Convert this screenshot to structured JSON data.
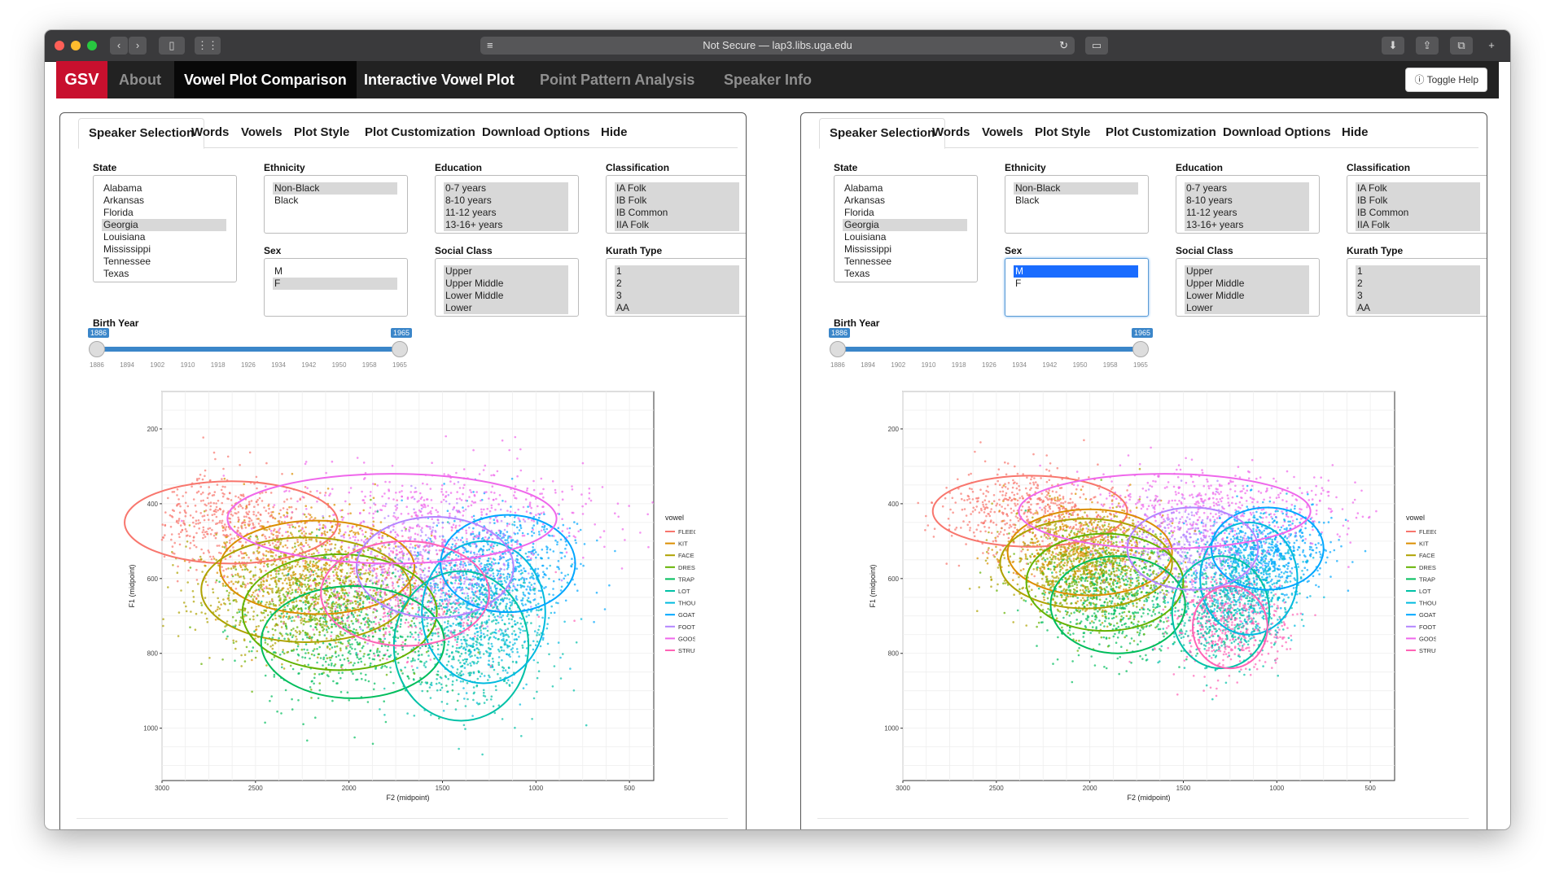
{
  "browser": {
    "url_text": "Not Secure — lap3.libs.uga.edu"
  },
  "navbar": {
    "brand": "GSV",
    "links": [
      "About",
      "Vowel Plot Comparison",
      "Interactive Vowel Plot",
      "Point Pattern Analysis",
      "Speaker Info"
    ],
    "toggle_help": "Toggle Help"
  },
  "tabs": [
    "Speaker Selection",
    "Words",
    "Vowels",
    "Plot Style",
    "Plot Customization",
    "Download Options",
    "Hide"
  ],
  "labels": {
    "state": "State",
    "ethnicity": "Ethnicity",
    "education": "Education",
    "classification": "Classification",
    "sex": "Sex",
    "social_class": "Social Class",
    "kurath_type": "Kurath Type",
    "birth_year": "Birth Year"
  },
  "options": {
    "state": [
      "Alabama",
      "Arkansas",
      "Florida",
      "Georgia",
      "Louisiana",
      "Mississippi",
      "Tennessee",
      "Texas"
    ],
    "ethnicity": [
      "Non-Black",
      "Black"
    ],
    "education": [
      "0-7 years",
      "8-10 years",
      "11-12 years",
      "13-16+ years"
    ],
    "classification": [
      "IA Folk",
      "IB Folk",
      "IB Common",
      "IIA Folk"
    ],
    "sex": [
      "M",
      "F"
    ],
    "social_class": [
      "Upper",
      "Upper Middle",
      "Lower Middle",
      "Lower"
    ],
    "kurath_type": [
      "1",
      "2",
      "3",
      "AA"
    ]
  },
  "left_panel": {
    "selected": {
      "state": [
        "Georgia"
      ],
      "ethnicity": [
        "Non-Black"
      ],
      "education": [
        "0-7 years",
        "8-10 years",
        "11-12 years",
        "13-16+ years"
      ],
      "classification": [
        "IA Folk",
        "IB Folk",
        "IB Common",
        "IIA Folk"
      ],
      "sex": [
        "F"
      ],
      "social_class": [
        "Upper",
        "Upper Middle",
        "Lower Middle",
        "Lower"
      ],
      "kurath_type": [
        "1",
        "2",
        "3",
        "AA"
      ]
    },
    "birth_year_range": [
      1886,
      1965
    ]
  },
  "right_panel": {
    "selected": {
      "state": [
        "Georgia"
      ],
      "ethnicity": [
        "Non-Black"
      ],
      "education": [
        "0-7 years",
        "8-10 years",
        "11-12 years",
        "13-16+ years"
      ],
      "classification": [
        "IA Folk",
        "IB Folk",
        "IB Common",
        "IIA Folk"
      ],
      "sex": [
        "M"
      ],
      "social_class": [
        "Upper",
        "Upper Middle",
        "Lower Middle",
        "Lower"
      ],
      "kurath_type": [
        "1",
        "2",
        "3",
        "AA"
      ]
    },
    "birth_year_range": [
      1886,
      1965
    ]
  },
  "slider": {
    "min": 1886,
    "max": 1965,
    "ticks": [
      "1886",
      "1894",
      "1902",
      "1910",
      "1918",
      "1926",
      "1934",
      "1942",
      "1950",
      "1958",
      "1965"
    ]
  },
  "chart_data": [
    {
      "type": "scatter",
      "panel": "left",
      "xlabel": "F2 (midpoint)",
      "ylabel": "F1 (midpoint)",
      "x_reversed": true,
      "y_reversed": true,
      "xlim": [
        3000,
        370
      ],
      "ylim": [
        100,
        1140
      ],
      "x_ticks": [
        3000,
        2500,
        2000,
        1500,
        1000,
        500
      ],
      "y_ticks": [
        200,
        400,
        600,
        800,
        1000
      ],
      "grid": true,
      "legend_title": "vowel",
      "legend_position": "right",
      "series": [
        {
          "name": "FLEECE",
          "color": "#F8766D",
          "center": [
            2650,
            450
          ],
          "sd": [
            230,
            65
          ],
          "ellipse": {
            "cx": 2630,
            "cy": 450,
            "rx": 570,
            "ry": 110
          }
        },
        {
          "name": "KIT",
          "color": "#DB8E00",
          "center": [
            2200,
            560
          ],
          "sd": [
            230,
            75
          ],
          "ellipse": {
            "cx": 2170,
            "cy": 570,
            "rx": 520,
            "ry": 125
          }
        },
        {
          "name": "FACE",
          "color": "#AEA200",
          "center": [
            2350,
            630
          ],
          "sd": [
            260,
            85
          ],
          "ellipse": {
            "cx": 2230,
            "cy": 630,
            "rx": 560,
            "ry": 140
          }
        },
        {
          "name": "DRESS",
          "color": "#64B200",
          "center": [
            2150,
            680
          ],
          "sd": [
            250,
            85
          ],
          "ellipse": {
            "cx": 2050,
            "cy": 690,
            "rx": 520,
            "ry": 155
          }
        },
        {
          "name": "TRAP",
          "color": "#00BD5C",
          "center": [
            2000,
            760
          ],
          "sd": [
            260,
            90
          ],
          "ellipse": {
            "cx": 1980,
            "cy": 770,
            "rx": 490,
            "ry": 150
          }
        },
        {
          "name": "LOT",
          "color": "#00C1A7",
          "center": [
            1380,
            760
          ],
          "sd": [
            200,
            100
          ],
          "ellipse": {
            "cx": 1400,
            "cy": 780,
            "rx": 360,
            "ry": 200
          }
        },
        {
          "name": "THOUGHT",
          "color": "#00BADE",
          "center": [
            1250,
            690
          ],
          "sd": [
            180,
            90
          ],
          "ellipse": {
            "cx": 1280,
            "cy": 690,
            "rx": 330,
            "ry": 190
          }
        },
        {
          "name": "GOAT",
          "color": "#00A6FF",
          "center": [
            1180,
            560
          ],
          "sd": [
            200,
            75
          ],
          "ellipse": {
            "cx": 1150,
            "cy": 560,
            "rx": 360,
            "ry": 130
          }
        },
        {
          "name": "FOOT",
          "color": "#B385FF",
          "center": [
            1550,
            560
          ],
          "sd": [
            250,
            75
          ],
          "ellipse": {
            "cx": 1540,
            "cy": 570,
            "rx": 420,
            "ry": 135
          }
        },
        {
          "name": "GOOSE",
          "color": "#EF67EB",
          "center": [
            1500,
            430
          ],
          "sd": [
            430,
            70
          ],
          "ellipse": {
            "cx": 1770,
            "cy": 440,
            "rx": 880,
            "ry": 120
          }
        },
        {
          "name": "STRUT",
          "color": "#FF63B6",
          "center": [
            1700,
            630
          ],
          "sd": [
            280,
            80
          ],
          "ellipse": {
            "cx": 1700,
            "cy": 640,
            "rx": 450,
            "ry": 140
          }
        }
      ]
    },
    {
      "type": "scatter",
      "panel": "right",
      "xlabel": "F2 (midpoint)",
      "ylabel": "F1 (midpoint)",
      "x_reversed": true,
      "y_reversed": true,
      "xlim": [
        3000,
        370
      ],
      "ylim": [
        100,
        1140
      ],
      "x_ticks": [
        3000,
        2500,
        2000,
        1500,
        1000,
        500
      ],
      "y_ticks": [
        200,
        400,
        600,
        800,
        1000
      ],
      "grid": true,
      "legend_title": "vowel",
      "legend_position": "right",
      "series": [
        {
          "name": "FLEECE",
          "color": "#F8766D",
          "center": [
            2350,
            420
          ],
          "sd": [
            220,
            55
          ],
          "ellipse": {
            "cx": 2320,
            "cy": 420,
            "rx": 520,
            "ry": 95
          }
        },
        {
          "name": "KIT",
          "color": "#DB8E00",
          "center": [
            2020,
            520
          ],
          "sd": [
            200,
            65
          ],
          "ellipse": {
            "cx": 2000,
            "cy": 530,
            "rx": 440,
            "ry": 115
          }
        },
        {
          "name": "FACE",
          "color": "#AEA200",
          "center": [
            2080,
            560
          ],
          "sd": [
            210,
            70
          ],
          "ellipse": {
            "cx": 2020,
            "cy": 560,
            "rx": 460,
            "ry": 120
          }
        },
        {
          "name": "DRESS",
          "color": "#64B200",
          "center": [
            1950,
            600
          ],
          "sd": [
            200,
            70
          ],
          "ellipse": {
            "cx": 1920,
            "cy": 610,
            "rx": 420,
            "ry": 130
          }
        },
        {
          "name": "TRAP",
          "color": "#00BD5C",
          "center": [
            1850,
            660
          ],
          "sd": [
            190,
            75
          ],
          "ellipse": {
            "cx": 1850,
            "cy": 670,
            "rx": 360,
            "ry": 130
          }
        },
        {
          "name": "LOT",
          "color": "#00C1A7",
          "center": [
            1280,
            690
          ],
          "sd": [
            150,
            70
          ],
          "ellipse": {
            "cx": 1300,
            "cy": 690,
            "rx": 260,
            "ry": 150
          }
        },
        {
          "name": "THOUGHT",
          "color": "#00BADE",
          "center": [
            1150,
            600
          ],
          "sd": [
            140,
            70
          ],
          "ellipse": {
            "cx": 1150,
            "cy": 600,
            "rx": 260,
            "ry": 150
          }
        },
        {
          "name": "GOAT",
          "color": "#00A6FF",
          "center": [
            1050,
            520
          ],
          "sd": [
            160,
            60
          ],
          "ellipse": {
            "cx": 1050,
            "cy": 520,
            "rx": 300,
            "ry": 110
          }
        },
        {
          "name": "FOOT",
          "color": "#B385FF",
          "center": [
            1450,
            520
          ],
          "sd": [
            200,
            60
          ],
          "ellipse": {
            "cx": 1450,
            "cy": 520,
            "rx": 350,
            "ry": 110
          }
        },
        {
          "name": "GOOSE",
          "color": "#EF67EB",
          "center": [
            1400,
            410
          ],
          "sd": [
            380,
            55
          ],
          "ellipse": {
            "cx": 1600,
            "cy": 420,
            "rx": 780,
            "ry": 100
          }
        },
        {
          "name": "STRUT",
          "color": "#FF63B6",
          "center": [
            1250,
            720
          ],
          "sd": [
            160,
            65
          ],
          "ellipse": {
            "cx": 1250,
            "cy": 730,
            "rx": 200,
            "ry": 110
          }
        }
      ]
    }
  ]
}
